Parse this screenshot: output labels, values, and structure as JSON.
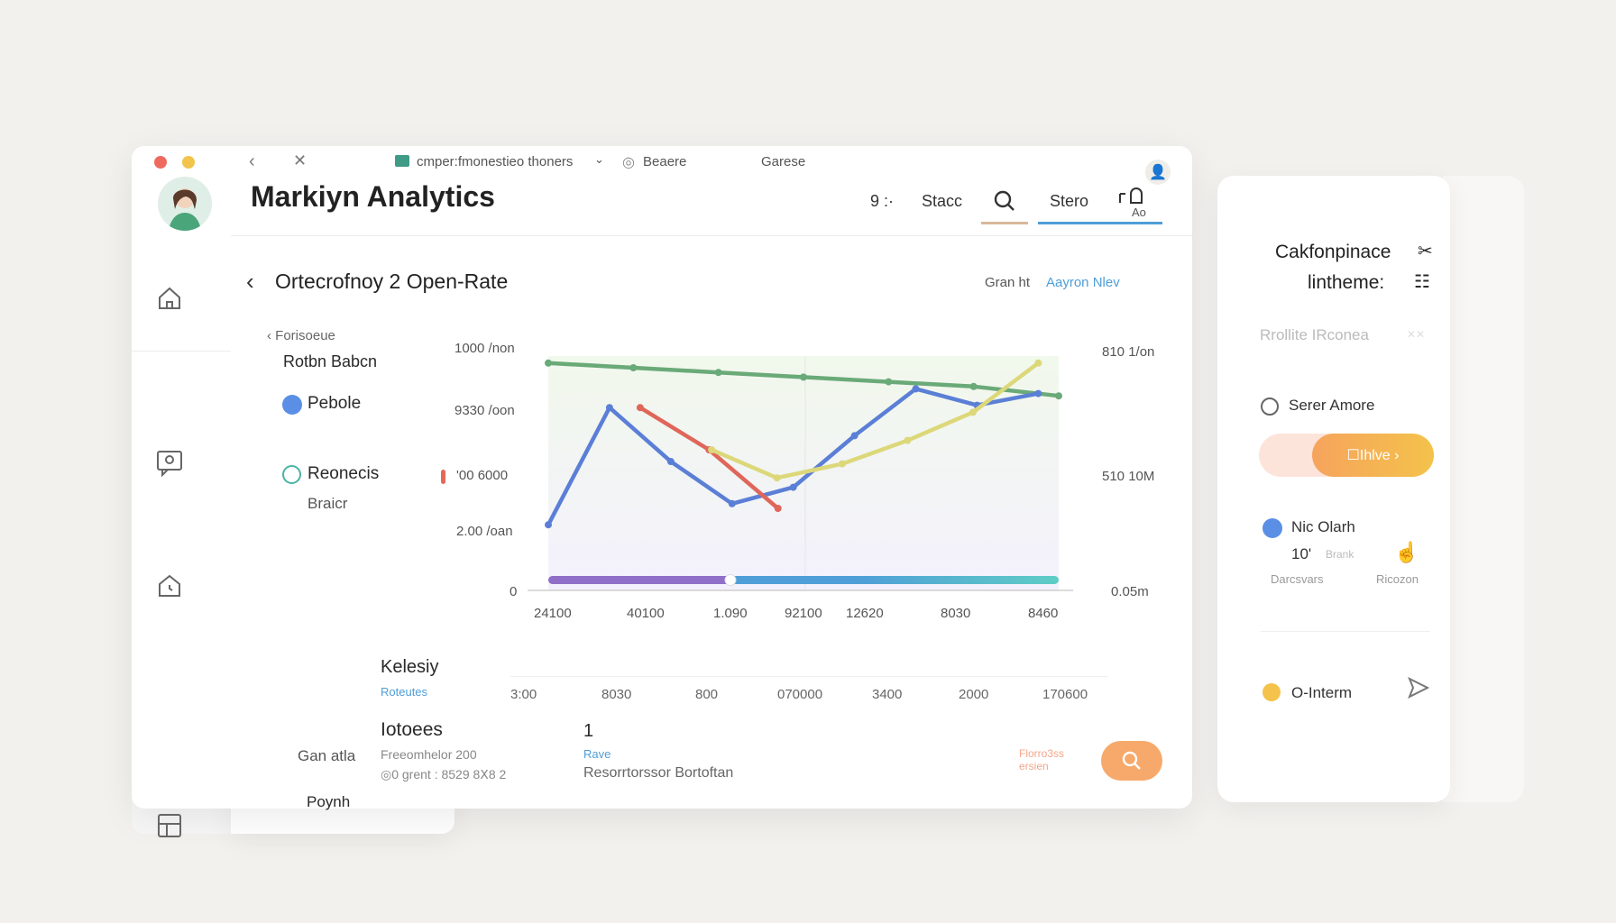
{
  "window": {
    "breadcrumb": "cmper:fmonestieo thoners",
    "tab_secondary": "Beaere",
    "tab_tertiary": "Garese"
  },
  "header": {
    "title": "Markiyn Analytics",
    "nav_time": "9 :·",
    "nav_stacc": "Stacc",
    "nav_stero": "Stero",
    "nav_ao": "Ao"
  },
  "content": {
    "subtitle": "Ortecrofnoy 2 Open-Rate",
    "view_prefix": "Gran ht",
    "view_link": "Aayron Nlev"
  },
  "legend": {
    "back_label": "Forisoeue",
    "group_title": "Rotbn Babcn",
    "item1": "Pebole",
    "item2": "Reonecis",
    "item2_sub": "Braicr",
    "extra1": "Gan atla",
    "extra2": "Poynh"
  },
  "chart_data": {
    "type": "line",
    "x_ticks": [
      "24100",
      "40100",
      "1.090",
      "92100",
      "12620",
      "8030",
      "8460"
    ],
    "y_left_ticks": [
      "1000 /non",
      "9330 /oon",
      "'00 6000",
      "2.00 /oan",
      "0"
    ],
    "y_right_ticks": [
      "810 1/on",
      "510 10M",
      "0.05m"
    ],
    "series": [
      {
        "name": "",
        "color": "#6aaa78",
        "values": [
          97,
          95,
          93,
          91,
          89,
          87,
          83
        ]
      },
      {
        "name": "",
        "color": "#5b7fd6",
        "values": [
          28,
          78,
          55,
          37,
          44,
          66,
          86,
          79,
          84
        ]
      },
      {
        "name": "",
        "color": "#e0665a",
        "values": [
          78,
          60,
          35
        ]
      },
      {
        "name": "",
        "color": "#dcd87a",
        "values": [
          60,
          48,
          54,
          64,
          76,
          97
        ]
      }
    ]
  },
  "bottom": {
    "label1": "Kelesiy",
    "label1_sub": "Roteutes",
    "x2_ticks": [
      "3:00",
      "8030",
      "800",
      "070000",
      "3400",
      "2000",
      "170600"
    ],
    "label2": "Iotoees",
    "label2_sub": "Freeomhelor 200",
    "label2_sub2": "◎0 grent : 8529 8Ⅹ8 2",
    "value": "1",
    "value_link": "Rave",
    "value_sub": "Resorrtorssor Bortoftan",
    "fab_text": "Florro3ss\nersien"
  },
  "panel": {
    "title_line1": "Cakfonpinace",
    "title_line2": "lintheme:",
    "faded_label": "Rrollite IRconea",
    "radio_label": "Serer Amore",
    "action_button": "☐Ihlve ›",
    "item_title": "Nic Olarh",
    "item_num": "10'",
    "item_num_suffix": "Brank",
    "item_sub1": "Darcsvars",
    "item_sub2": "Ricozon",
    "footer_label": "O-Interm"
  }
}
